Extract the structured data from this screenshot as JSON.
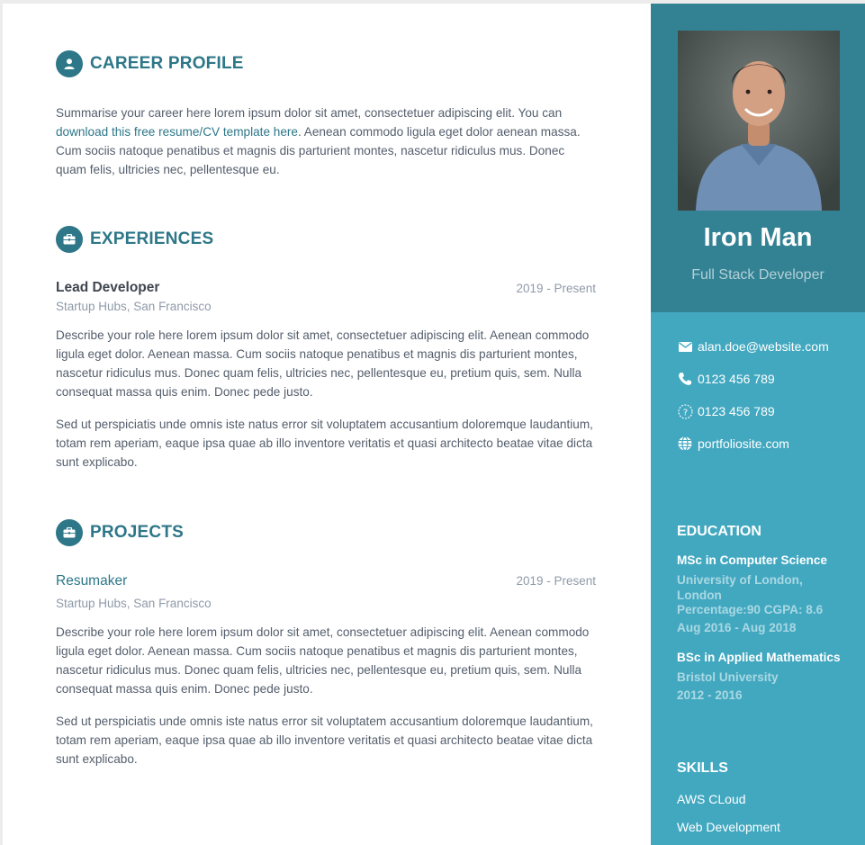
{
  "career_profile": {
    "title": "Career Profile",
    "text_before_link": "Summarise your career here lorem ipsum dolor sit amet, consectetuer adipiscing elit. You can ",
    "link_text": "download this free resume/CV template here",
    "text_after_link": ". Aenean commodo ligula eget dolor aenean massa. Cum sociis natoque penatibus et magnis dis parturient montes, nascetur ridiculus mus. Donec quam felis, ultricies nec, pellentesque eu."
  },
  "experiences": {
    "title": "Experiences",
    "items": [
      {
        "role": "Lead Developer",
        "date": "2019 - Present",
        "company": "Startup Hubs, San Francisco",
        "para1": "Describe your role here lorem ipsum dolor sit amet, consectetuer adipiscing elit. Aenean commodo ligula eget dolor. Aenean massa. Cum sociis natoque penatibus et magnis dis parturient montes, nascetur ridiculus mus. Donec quam felis, ultricies nec, pellentesque eu, pretium quis, sem. Nulla consequat massa quis enim. Donec pede justo.",
        "para2": "Sed ut perspiciatis unde omnis iste natus error sit voluptatem accusantium doloremque laudantium, totam rem aperiam, eaque ipsa quae ab illo inventore veritatis et quasi architecto beatae vitae dicta sunt explicabo."
      }
    ]
  },
  "projects": {
    "title": "Projects",
    "items": [
      {
        "name": "Resumaker",
        "date": "2019 - Present",
        "company": "Startup Hubs, San Francisco",
        "para1": "Describe your role here lorem ipsum dolor sit amet, consectetuer adipiscing elit. Aenean commodo ligula eget dolor. Aenean massa. Cum sociis natoque penatibus et magnis dis parturient montes, nascetur ridiculus mus. Donec quam felis, ultricies nec, pellentesque eu, pretium quis, sem. Nulla consequat massa quis enim. Donec pede justo.",
        "para2": "Sed ut perspiciatis unde omnis iste natus error sit voluptatem accusantium doloremque laudantium, totam rem aperiam, eaque ipsa quae ab illo inventore veritatis et quasi architecto beatae vitae dicta sunt explicabo."
      }
    ]
  },
  "profile": {
    "name": "Iron Man",
    "tagline": "Full Stack Developer"
  },
  "contact": {
    "email": "alan.doe@website.com",
    "phone": "0123 456 789",
    "alt_phone": "0123 456 789",
    "website": "portfoliosite.com"
  },
  "education": {
    "title": "Education",
    "items": [
      {
        "degree": "MSc in Computer Science",
        "school": "University of London, London",
        "score": "Percentage:90 CGPA: 8.6",
        "dates": "Aug 2016 - Aug 2018"
      },
      {
        "degree": "BSc in Applied Mathematics",
        "school": "Bristol University",
        "dates": "2012 - 2016"
      }
    ]
  },
  "skills": {
    "title": "Skills",
    "items": [
      "AWS CLoud",
      "Web Development"
    ]
  },
  "colors": {
    "accent": "#2d7788",
    "sidebar": "#42a8c0",
    "profile_box": "#338294"
  }
}
